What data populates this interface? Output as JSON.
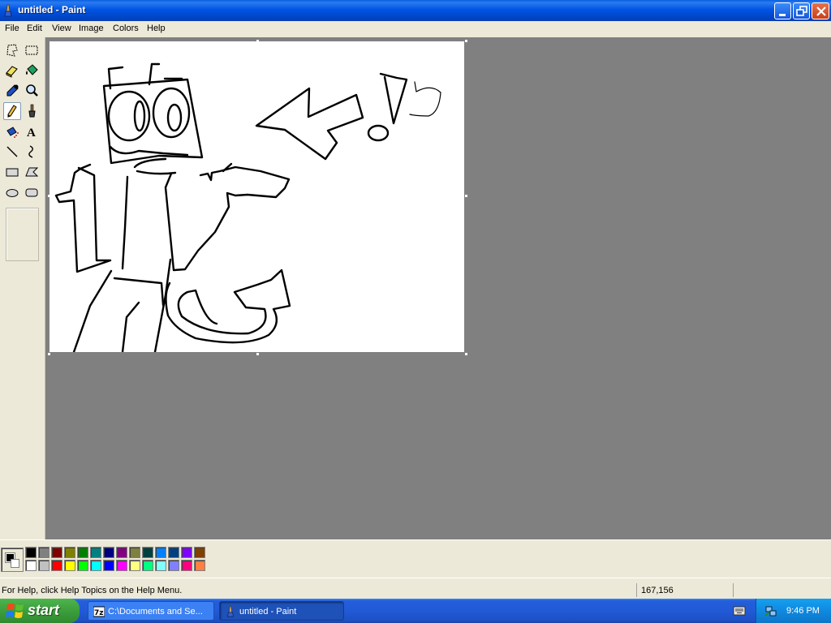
{
  "window": {
    "title": "untitled - Paint"
  },
  "menu": [
    "File",
    "Edit",
    "View",
    "Image",
    "Colors",
    "Help"
  ],
  "tools": [
    "free-form-select",
    "rectangle-select",
    "eraser",
    "fill-with-color",
    "pick-color",
    "magnifier",
    "pencil",
    "brush",
    "airbrush",
    "text",
    "line",
    "curve",
    "rectangle",
    "polygon",
    "ellipse",
    "rounded-rectangle"
  ],
  "selected_tool": "pencil",
  "colors": {
    "foreground": "#000000",
    "background": "#ffffff",
    "palette_top": [
      "#000000",
      "#808080",
      "#800000",
      "#808000",
      "#008000",
      "#008080",
      "#000080",
      "#800080",
      "#808040",
      "#004040",
      "#0080ff",
      "#004080",
      "#8000ff",
      "#804000"
    ],
    "palette_bottom": [
      "#ffffff",
      "#c0c0c0",
      "#ff0000",
      "#ffff00",
      "#00ff00",
      "#00ffff",
      "#0000ff",
      "#ff00ff",
      "#ffff80",
      "#00ff80",
      "#80ffff",
      "#8080ff",
      "#ff0080",
      "#ff8040"
    ]
  },
  "status": {
    "help": "For Help, click Help Topics on the Help Menu.",
    "coords": "167,156"
  },
  "taskbar": {
    "start_label": "start",
    "tasks": [
      {
        "label": "C:\\Documents and Se...",
        "icon": "7zip-icon",
        "active": false
      },
      {
        "label": "untitled - Paint",
        "icon": "paint-icon",
        "active": true
      }
    ],
    "clock": "9:46 PM"
  }
}
